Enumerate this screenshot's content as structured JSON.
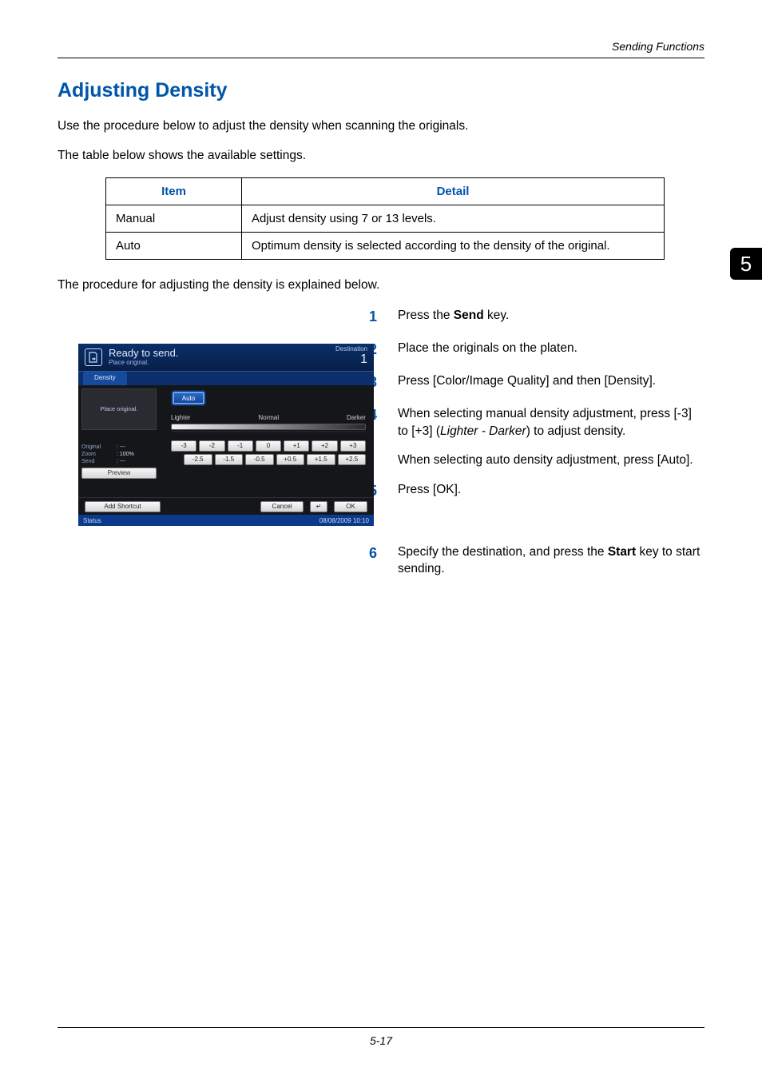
{
  "running_header": "Sending Functions",
  "section_title": "Adjusting Density",
  "intro_paragraphs": [
    "Use the procedure below to adjust the density when scanning the originals.",
    "The table below shows the available settings."
  ],
  "table": {
    "headers": [
      "Item",
      "Detail"
    ],
    "rows": [
      [
        "Manual",
        "Adjust density using 7 or 13 levels."
      ],
      [
        "Auto",
        "Optimum density is selected according to the density of the original."
      ]
    ]
  },
  "after_table": "The procedure for adjusting the density is explained below.",
  "chapter_number": "5",
  "steps": [
    {
      "paras": [
        {
          "type": "rich",
          "segments": [
            {
              "t": "Press the "
            },
            {
              "t": "Send",
              "b": true
            },
            {
              "t": " key."
            }
          ]
        }
      ]
    },
    {
      "paras": [
        "Place the originals on the platen."
      ]
    },
    {
      "paras": [
        "Press [Color/Image Quality] and then [Density]."
      ]
    },
    {
      "paras": [
        {
          "type": "rich",
          "segments": [
            {
              "t": "When selecting manual density adjustment, press [-3] to [+3] ("
            },
            {
              "t": "Lighter - Darker",
              "i": true
            },
            {
              "t": ") to adjust density."
            }
          ]
        },
        "When selecting auto density adjustment, press [Auto]."
      ]
    },
    {
      "paras": [
        "Press [OK]."
      ]
    },
    {
      "gap": true,
      "paras": [
        {
          "type": "rich",
          "segments": [
            {
              "t": "Specify the destination, and press the "
            },
            {
              "t": "Start",
              "b": true
            },
            {
              "t": " key to start sending."
            }
          ]
        }
      ]
    }
  ],
  "page_number": "5-17",
  "screenshot": {
    "header": {
      "icon": "document-out-icon",
      "title": "Ready to send.",
      "subtitle": "Place original.",
      "right_label": "Destination",
      "right_count": "1"
    },
    "tab": "Density",
    "side": {
      "placeholder": "Place original.",
      "rows": [
        {
          "label": "Original",
          "value": ": ---"
        },
        {
          "label": "Zoom",
          "value": ": 100%"
        },
        {
          "label": "Send",
          "value": ": ---"
        }
      ],
      "preview_btn": "Preview"
    },
    "main": {
      "auto_btn": "Auto",
      "labels": [
        "Lighter",
        "Normal",
        "Darker"
      ],
      "row1": [
        "-3",
        "-2",
        "-1",
        "0",
        "+1",
        "+2",
        "+3"
      ],
      "row2": [
        "-2.5",
        "-1.5",
        "-0.5",
        "+0.5",
        "+1.5",
        "+2.5"
      ]
    },
    "footer": {
      "add_shortcut": "Add Shortcut",
      "cancel": "Cancel",
      "enter": "↵",
      "ok": "OK"
    },
    "statusbar": {
      "left": "Status",
      "right": "08/08/2009   10:10"
    }
  }
}
